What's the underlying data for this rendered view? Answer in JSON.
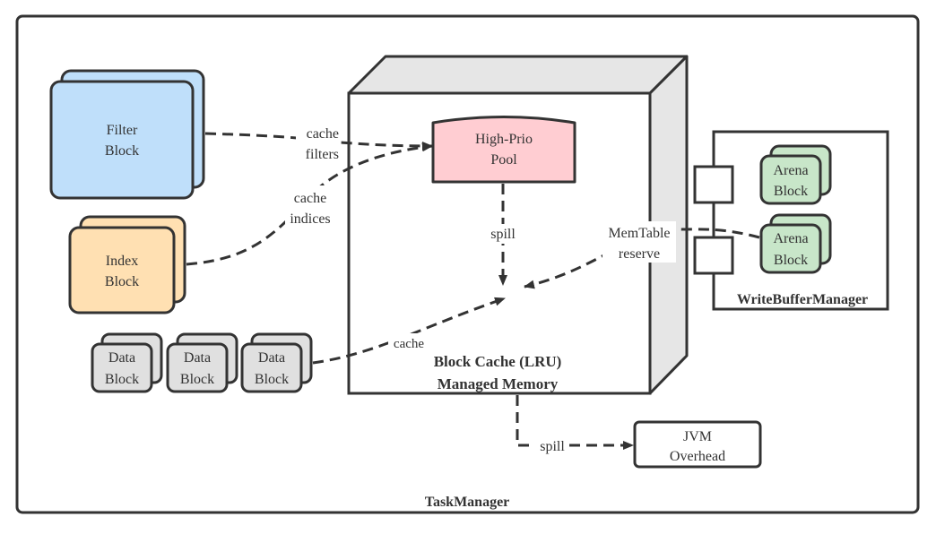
{
  "diagram": {
    "container_label": "TaskManager",
    "block_cache": {
      "title_line1": "Block Cache (LRU)",
      "title_line2": "Managed Memory",
      "high_prio_pool": {
        "line1": "High-Prio",
        "line2": "Pool"
      }
    },
    "filter_block": {
      "line1": "Filter",
      "line2": "Block"
    },
    "index_block": {
      "line1": "Index",
      "line2": "Block"
    },
    "data_blocks": [
      {
        "line1": "Data",
        "line2": "Block"
      },
      {
        "line1": "Data",
        "line2": "Block"
      },
      {
        "line1": "Data",
        "line2": "Block"
      }
    ],
    "write_buffer_manager": {
      "label": "WriteBufferManager",
      "arena_blocks": [
        {
          "line1": "Arena",
          "line2": "Block"
        },
        {
          "line1": "Arena",
          "line2": "Block"
        }
      ]
    },
    "jvm_overhead": {
      "line1": "JVM",
      "line2": "Overhead"
    },
    "edges": {
      "cache_filters": {
        "line1": "cache",
        "line2": "filters"
      },
      "cache_indices": {
        "line1": "cache",
        "line2": "indices"
      },
      "spill_pool": "spill",
      "memtable_reserve": {
        "line1": "MemTable",
        "line2": "reserve"
      },
      "cache_data": "cache",
      "spill_jvm": "spill"
    },
    "colors": {
      "filter_fill": "#BFDFFA",
      "index_fill": "#FFE0B2",
      "data_fill": "#E0E0E0",
      "pool_fill": "#FFCDD2",
      "arena_fill": "#C8E6C9",
      "cube_side_fill": "#E6E6E6",
      "stroke": "#333333"
    }
  }
}
